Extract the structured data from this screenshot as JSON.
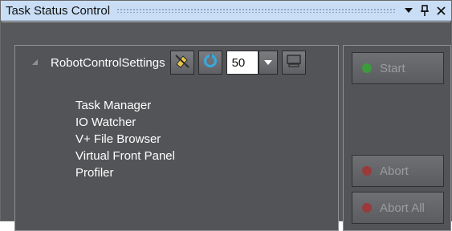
{
  "window": {
    "title": "Task Status Control",
    "icons": [
      "dropdown-arrow-icon",
      "pin-icon",
      "close-icon"
    ]
  },
  "tree": {
    "root_label": "RobotControlSettings",
    "count_value": "50",
    "children": [
      "Task Manager",
      "IO Watcher",
      "V+ File Browser",
      "Virtual Front Panel",
      "Profiler"
    ]
  },
  "buttons": {
    "start_label": "Start",
    "abort_label": "Abort",
    "abort_all_label": "Abort All"
  },
  "colors": {
    "start_indicator": "#3c9b3c",
    "abort_indicator": "#9a3a3a",
    "titlebar": "#c9def5",
    "panel": "#56585b"
  }
}
